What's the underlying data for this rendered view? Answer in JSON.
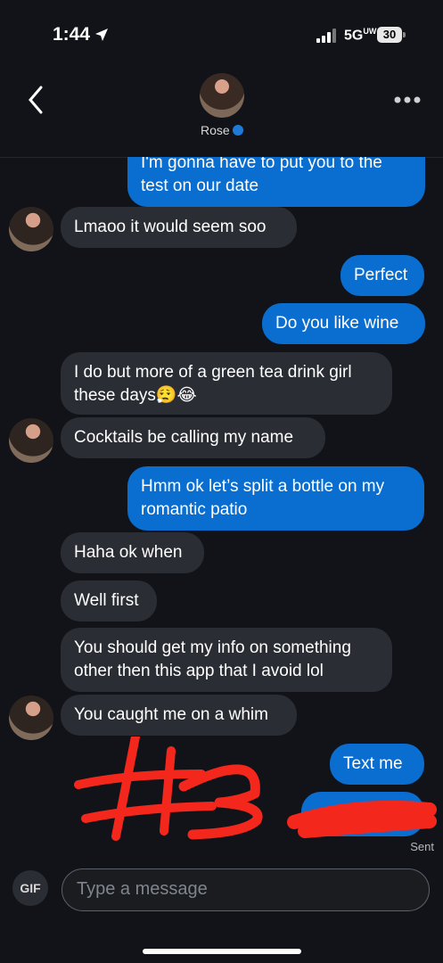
{
  "status_bar": {
    "time": "1:44",
    "network": "5G",
    "network_sub": "UW",
    "battery": "30",
    "location_icon": "navigation-arrow-icon",
    "signal_icon": "cellular-signal-icon"
  },
  "header": {
    "contact_name": "Rose",
    "back_icon": "chevron-left-icon",
    "more_icon": "more-horizontal-icon",
    "verified_icon": "verified-badge-icon"
  },
  "messages": [
    {
      "direction": "out",
      "text": "I'm gonna have to put you to the test on our date"
    },
    {
      "direction": "in",
      "text": "Lmaoo it would seem soo"
    },
    {
      "direction": "out",
      "text": "Perfect"
    },
    {
      "direction": "out",
      "text": "Do you like wine"
    },
    {
      "direction": "in",
      "text": "I do but more of a green tea drink girl these days😮‍💨😂"
    },
    {
      "direction": "in",
      "text": "Cocktails be calling my name"
    },
    {
      "direction": "out",
      "text": "Hmm ok let’s split a bottle on my romantic patio"
    },
    {
      "direction": "in",
      "text": "Haha ok when"
    },
    {
      "direction": "in",
      "text": "Well first"
    },
    {
      "direction": "in",
      "text": "You should get my info on something other then this app that I avoid lol"
    },
    {
      "direction": "in",
      "text": "You caught me on a whim"
    },
    {
      "direction": "out",
      "text": "Text me"
    },
    {
      "direction": "out",
      "text": ""
    }
  ],
  "message_status": "Sent",
  "composer": {
    "gif_label": "GIF",
    "placeholder": "Type a message"
  },
  "colors": {
    "background": "#111318",
    "incoming_bubble": "#2a2d33",
    "outgoing_bubble": "#0a6ed1",
    "redaction_mark": "#f4271d"
  }
}
